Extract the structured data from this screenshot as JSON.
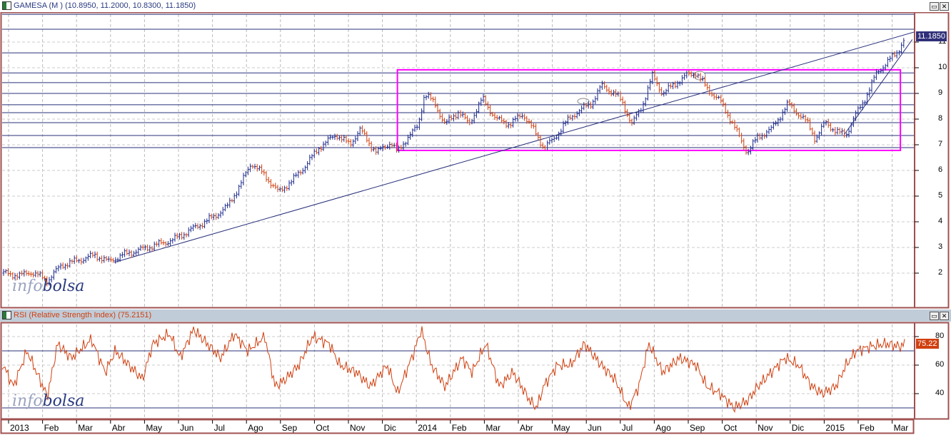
{
  "price_panel": {
    "title": "GAMESA (M ) (10.8950, 11.2000, 10.8300, 11.1850)",
    "last_value": "11.1850",
    "axis_labels": [
      "2",
      "3",
      "4",
      "5",
      "6",
      "7",
      "8",
      "9",
      "10",
      "11"
    ]
  },
  "rsi_panel": {
    "title": "RSI (Relative Strength Index) (75.2151)",
    "last_value": "75.22",
    "axis_labels": [
      "80",
      "60",
      "40"
    ]
  },
  "x_axis": {
    "labels": [
      "2013",
      "Feb",
      "Mar",
      "Abr",
      "May",
      "Jun",
      "Jul",
      "Ago",
      "Sep",
      "Oct",
      "Nov",
      "Dic",
      "2014",
      "Feb",
      "Mar",
      "Abr",
      "May",
      "Jun",
      "Jul",
      "Ago",
      "Sep",
      "Oct",
      "Nov",
      "Dic",
      "2015",
      "Feb",
      "Mar"
    ]
  },
  "watermark": {
    "part1": "info",
    "part2": "bolsa"
  },
  "window_buttons": {
    "maximize": "▭",
    "close": "✕"
  },
  "colors": {
    "up": "#1c2a8c",
    "down": "#d04010",
    "support": "#28307a",
    "box": "#ff00ff",
    "rsi": "#d04010",
    "frame": "#a05050"
  },
  "chart_data": [
    {
      "type": "line",
      "title": "GAMESA (M )",
      "x_unit": "months since Jan 2013",
      "ylim": [
        1,
        12
      ],
      "ohlc_last": {
        "open": 10.895,
        "high": 11.2,
        "low": 10.83,
        "close": 11.185
      },
      "price_points": [
        [
          -0.2,
          2.0
        ],
        [
          0.3,
          1.9
        ],
        [
          0.6,
          2.05
        ],
        [
          1.0,
          1.8
        ],
        [
          1.1,
          1.7
        ],
        [
          1.5,
          2.3
        ],
        [
          2.0,
          2.5
        ],
        [
          2.5,
          2.7
        ],
        [
          2.9,
          2.45
        ],
        [
          3.3,
          2.7
        ],
        [
          3.8,
          2.9
        ],
        [
          4.3,
          3.1
        ],
        [
          4.8,
          3.3
        ],
        [
          5.2,
          3.6
        ],
        [
          5.6,
          3.9
        ],
        [
          6.0,
          4.2
        ],
        [
          6.4,
          4.6
        ],
        [
          6.8,
          5.5
        ],
        [
          7.1,
          6.3
        ],
        [
          7.5,
          5.8
        ],
        [
          7.9,
          5.15
        ],
        [
          8.3,
          5.6
        ],
        [
          8.7,
          6.2
        ],
        [
          9.1,
          6.9
        ],
        [
          9.6,
          7.4
        ],
        [
          10.0,
          7.0
        ],
        [
          10.3,
          7.6
        ],
        [
          10.6,
          7.0
        ],
        [
          10.8,
          6.7
        ],
        [
          11.2,
          7.1
        ],
        [
          11.4,
          6.7
        ],
        [
          11.7,
          7.3
        ],
        [
          12.0,
          7.7
        ],
        [
          12.2,
          9.0
        ],
        [
          12.5,
          8.6
        ],
        [
          12.8,
          7.8
        ],
        [
          13.2,
          8.3
        ],
        [
          13.5,
          7.8
        ],
        [
          13.9,
          8.8
        ],
        [
          14.3,
          8.0
        ],
        [
          14.7,
          7.8
        ],
        [
          15.1,
          8.2
        ],
        [
          15.4,
          7.6
        ],
        [
          15.7,
          6.9
        ],
        [
          16.0,
          7.2
        ],
        [
          16.3,
          7.8
        ],
        [
          16.7,
          8.3
        ],
        [
          17.1,
          8.6
        ],
        [
          17.4,
          9.3
        ],
        [
          17.8,
          9.0
        ],
        [
          18.0,
          8.7
        ],
        [
          18.3,
          7.8
        ],
        [
          18.6,
          8.5
        ],
        [
          18.9,
          9.7
        ],
        [
          19.2,
          9.0
        ],
        [
          19.5,
          9.3
        ],
        [
          19.9,
          9.7
        ],
        [
          20.2,
          9.8
        ],
        [
          20.5,
          9.2
        ],
        [
          20.9,
          8.7
        ],
        [
          21.2,
          8.0
        ],
        [
          21.5,
          7.2
        ],
        [
          21.7,
          6.7
        ],
        [
          22.0,
          7.3
        ],
        [
          22.4,
          7.6
        ],
        [
          22.6,
          8.0
        ],
        [
          22.9,
          8.6
        ],
        [
          23.2,
          8.2
        ],
        [
          23.5,
          7.8
        ],
        [
          23.7,
          7.2
        ],
        [
          24.0,
          7.9
        ],
        [
          24.3,
          7.5
        ],
        [
          24.6,
          7.4
        ],
        [
          24.9,
          8.2
        ],
        [
          25.2,
          8.9
        ],
        [
          25.5,
          9.8
        ],
        [
          25.8,
          10.2
        ],
        [
          26.1,
          10.6
        ],
        [
          26.35,
          11.19
        ]
      ],
      "support_levels": [
        12.08,
        11.5,
        10.58,
        9.8,
        9.42,
        9.0,
        8.56,
        8.25,
        7.86,
        7.36,
        6.89
      ],
      "range_box": {
        "from_month": 11.4,
        "to_month": 26.2,
        "low": 6.78,
        "high": 9.92
      },
      "trendlines": [
        [
          [
            3.07,
            2.42
          ],
          [
            26.6,
            11.39
          ]
        ],
        [
          [
            24.56,
            7.42
          ],
          [
            26.55,
            11.1
          ]
        ]
      ]
    },
    {
      "type": "line",
      "title": "RSI (Relative Strength Index)",
      "ylim": [
        25,
        90
      ],
      "reference_levels": [
        70,
        30
      ],
      "last": 75.2151,
      "points": [
        [
          -0.2,
          60
        ],
        [
          0.1,
          45
        ],
        [
          0.5,
          70
        ],
        [
          1.1,
          38
        ],
        [
          1.4,
          75
        ],
        [
          1.8,
          65
        ],
        [
          2.4,
          78
        ],
        [
          2.8,
          55
        ],
        [
          3.1,
          70
        ],
        [
          3.5,
          60
        ],
        [
          3.9,
          50
        ],
        [
          4.2,
          75
        ],
        [
          4.7,
          82
        ],
        [
          5.0,
          65
        ],
        [
          5.4,
          85
        ],
        [
          5.8,
          75
        ],
        [
          6.2,
          65
        ],
        [
          6.6,
          82
        ],
        [
          7.0,
          70
        ],
        [
          7.5,
          80
        ],
        [
          7.8,
          45
        ],
        [
          8.1,
          50
        ],
        [
          8.5,
          60
        ],
        [
          8.9,
          80
        ],
        [
          9.4,
          75
        ],
        [
          9.7,
          60
        ],
        [
          10.2,
          55
        ],
        [
          10.6,
          45
        ],
        [
          11.1,
          60
        ],
        [
          11.4,
          40
        ],
        [
          11.9,
          70
        ],
        [
          12.1,
          85
        ],
        [
          12.4,
          60
        ],
        [
          12.8,
          45
        ],
        [
          13.3,
          65
        ],
        [
          13.6,
          55
        ],
        [
          14.0,
          75
        ],
        [
          14.4,
          45
        ],
        [
          14.8,
          55
        ],
        [
          15.3,
          35
        ],
        [
          15.5,
          30
        ],
        [
          15.7,
          45
        ],
        [
          16.1,
          60
        ],
        [
          16.5,
          60
        ],
        [
          16.9,
          75
        ],
        [
          17.4,
          60
        ],
        [
          17.8,
          50
        ],
        [
          18.2,
          30
        ],
        [
          18.5,
          45
        ],
        [
          18.8,
          75
        ],
        [
          19.2,
          55
        ],
        [
          19.7,
          65
        ],
        [
          20.2,
          60
        ],
        [
          20.5,
          45
        ],
        [
          20.9,
          40
        ],
        [
          21.3,
          30
        ],
        [
          21.7,
          35
        ],
        [
          22.0,
          45
        ],
        [
          22.4,
          55
        ],
        [
          22.8,
          65
        ],
        [
          23.2,
          60
        ],
        [
          23.6,
          45
        ],
        [
          23.9,
          40
        ],
        [
          24.3,
          45
        ],
        [
          24.6,
          60
        ],
        [
          24.9,
          70
        ],
        [
          25.3,
          73
        ],
        [
          25.8,
          75
        ],
        [
          26.2,
          73
        ],
        [
          26.35,
          75.2
        ]
      ]
    }
  ]
}
